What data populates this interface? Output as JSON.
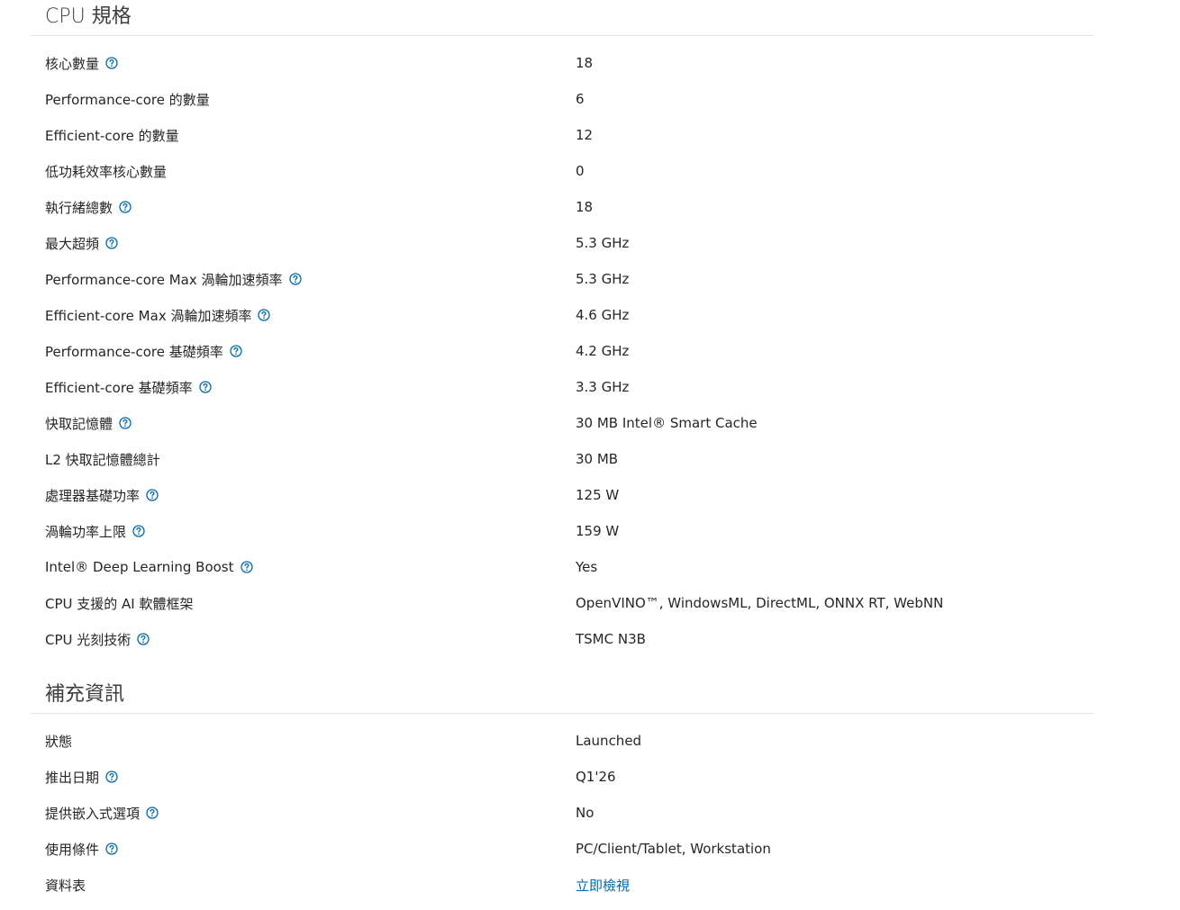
{
  "colors": {
    "help_icon": "#0068b5",
    "link": "#0068b5",
    "text": "#262626",
    "divider": "#e2e2e2"
  },
  "sections": [
    {
      "title": "CPU 規格",
      "rows": [
        {
          "label": "核心數量",
          "value": "18",
          "help": true
        },
        {
          "label": "Performance-core 的數量",
          "value": "6",
          "help": false
        },
        {
          "label": "Efficient-core 的數量",
          "value": "12",
          "help": false
        },
        {
          "label": "低功耗效率核心數量",
          "value": "0",
          "help": false
        },
        {
          "label": "執行緒總數",
          "value": "18",
          "help": true
        },
        {
          "label": "最大超頻",
          "value": "5.3 GHz",
          "help": true
        },
        {
          "label": "Performance-core Max 渦輪加速頻率",
          "value": "5.3 GHz",
          "help": true
        },
        {
          "label": "Efficient-core Max 渦輪加速頻率",
          "value": "4.6 GHz",
          "help": true
        },
        {
          "label": "Performance-core 基礎頻率",
          "value": "4.2 GHz",
          "help": true
        },
        {
          "label": "Efficient-core 基礎頻率",
          "value": "3.3 GHz",
          "help": true
        },
        {
          "label": "快取記憶體",
          "value": "30 MB Intel® Smart Cache",
          "help": true
        },
        {
          "label": "L2 快取記憶體總計",
          "value": "30 MB",
          "help": false
        },
        {
          "label": "處理器基礎功率",
          "value": "125 W",
          "help": true
        },
        {
          "label": "渦輪功率上限",
          "value": "159 W",
          "help": true
        },
        {
          "label": "Intel® Deep Learning Boost",
          "value": "Yes",
          "help": true
        },
        {
          "label": "CPU 支援的 AI 軟體框架",
          "value": "OpenVINO™, WindowsML, DirectML, ONNX RT, WebNN",
          "help": false
        },
        {
          "label": "CPU 光刻技術",
          "value": "TSMC N3B",
          "help": true
        }
      ]
    },
    {
      "title": "補充資訊",
      "rows": [
        {
          "label": "狀態",
          "value": "Launched",
          "help": false
        },
        {
          "label": "推出日期",
          "value": "Q1'26",
          "help": true
        },
        {
          "label": "提供嵌入式選項",
          "value": "No",
          "help": true
        },
        {
          "label": "使用條件",
          "value": "PC/Client/Tablet, Workstation",
          "help": true
        },
        {
          "label": "資料表",
          "value": "立即檢視",
          "help": false,
          "link": true
        }
      ]
    }
  ]
}
